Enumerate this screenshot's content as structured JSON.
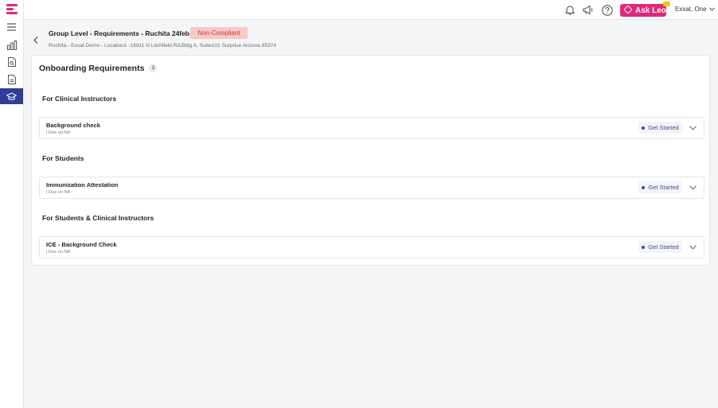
{
  "topbar": {
    "ask_leo_label": "Ask Leo",
    "user_name": "Exxat, One",
    "icons": [
      "bell-icon",
      "megaphone-icon",
      "help-icon",
      "leo-icon",
      "chevron-down-icon"
    ]
  },
  "sidebar": {
    "items": [
      {
        "icon": "menu-icon"
      },
      {
        "icon": "bar-chart-icon"
      },
      {
        "icon": "document-search-icon"
      },
      {
        "icon": "document-list-icon"
      },
      {
        "icon": "graduation-cap-icon",
        "active": true
      }
    ]
  },
  "header": {
    "title": "Group Level - Requirements - Ruchita 24feb",
    "status": "Non-Compliant",
    "subtitle": "Ruchita - Exxat Demo - Location1 -16811 N Litchfield Rd,Bldg A, Suite101 Surprise Arizona 85374"
  },
  "main": {
    "heading": "Onboarding Requirements",
    "count": "3",
    "groups": [
      {
        "title": "For Clinical Instructors",
        "requirement": {
          "name": "Background check",
          "due": "| Due on:NA",
          "status": "Get Started"
        }
      },
      {
        "title": "For Students",
        "requirement": {
          "name": "Immunization Attestation",
          "due": "| Due on:NA",
          "status": "Get Started"
        }
      },
      {
        "title": "For Students & Clinical Instructors",
        "requirement": {
          "name": "ICE - Background Check",
          "due": "| Due on:NA",
          "status": "Get Started"
        }
      }
    ]
  },
  "colors": {
    "brand_pink": "#e0287a",
    "active_nav": "#2f3d97",
    "non_compliant_bg": "#f8c7c7",
    "non_compliant_text": "#c53b3b",
    "status_text": "#3f4b8f"
  }
}
